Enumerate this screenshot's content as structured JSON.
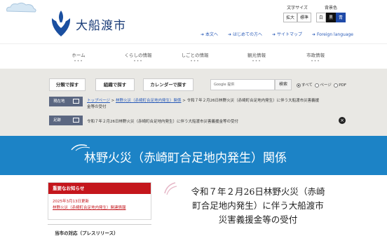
{
  "header": {
    "site_name": "大船渡市",
    "text_size": {
      "label": "文字サイズ",
      "enlarge": "拡大",
      "standard": "標準"
    },
    "bg_color": {
      "label": "背景色",
      "white": "白",
      "black": "黒",
      "blue": "青"
    },
    "util_links": [
      "本文へ",
      "はじめての方へ",
      "サイトマップ",
      "Foreign language"
    ]
  },
  "gnav": {
    "items": [
      "ホーム",
      "くらしの情報",
      "しごとの情報",
      "観光情報",
      "市政情報"
    ],
    "dots": "•••"
  },
  "search": {
    "buttons": [
      "分類で探す",
      "組織で探す",
      "カレンダーで探す"
    ],
    "google_placeholder": "Google 提供",
    "submit": "検索",
    "scope_options": [
      "すべて",
      "ページ",
      "PDF"
    ],
    "scope_selected": "すべて"
  },
  "breadcrumb": {
    "tag": "現在地",
    "links": [
      "トップページ",
      "林野火災（赤崎町合足地内発生）関係"
    ],
    "current_line1": "令和７年２月26日林野火災（赤崎町合足地内発生）に伴う大船渡市災害義援",
    "current_line2": "金等の受付",
    "separator": ">"
  },
  "footprint": {
    "tag": "足跡",
    "text": "令和７年２月26日林野火災（赤崎町合足地内発生）に伴う大船渡市災害義援金等の受付",
    "close": "×"
  },
  "banner": {
    "title": "林野火災（赤崎町合足地内発生）関係"
  },
  "notice": {
    "heading": "重要なお知らせ",
    "date": "2025年3月13日更新",
    "link": "林野火災（赤崎町合足地内発生）関連情報"
  },
  "response": {
    "heading": "当市の対応（プレスリリース）"
  },
  "page": {
    "title_line1": "令和７年２月26日林野火災（赤崎",
    "title_line2": "町合足地内発生）に伴う大船渡市",
    "title_line3": "災害義援金等の受付"
  },
  "colors": {
    "banner_blue": "#1c83c6",
    "brand_navy": "#1a3c78",
    "notice_red": "#c4161c",
    "band_gray": "#e9e8e4"
  }
}
